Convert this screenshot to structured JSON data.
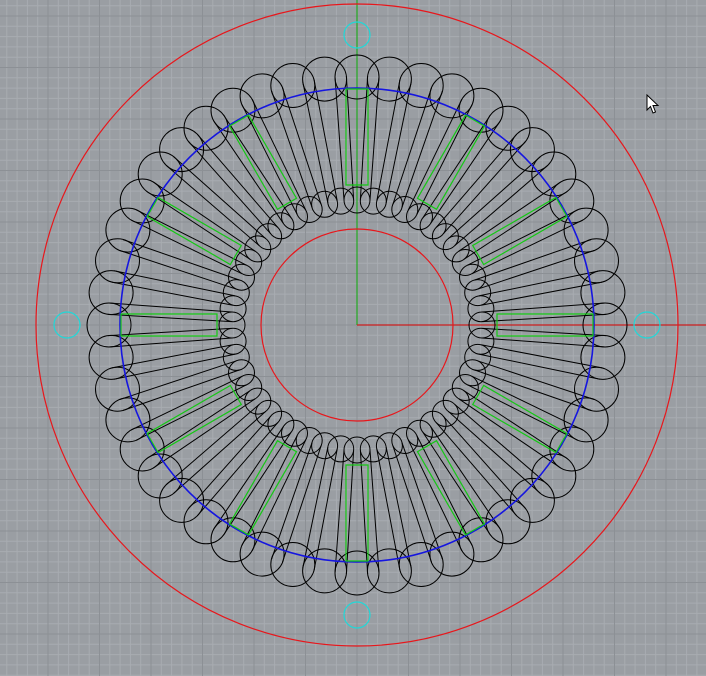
{
  "viewport": {
    "background_color": "#9a9ea3",
    "grid_minor_color": "#a8acb1",
    "grid_major_color": "#8c9095",
    "axis_x_color": "#cc1e1e",
    "axis_y_color": "#22aa22"
  },
  "drawing": {
    "outer_ring_color": "#e8161b",
    "bore_circle_color": "#e8161b",
    "pitch_circle_color": "#1515e0",
    "slot_outline_color": "#000000",
    "winding_color": "#14c814",
    "mounting_hole_color": "#20d8d8",
    "slot_count": 48,
    "mounting_hole_count": 4,
    "winding_groups": 12
  },
  "cursor": {
    "icon": "arrow-pointer-icon",
    "color": "#ffffff"
  }
}
